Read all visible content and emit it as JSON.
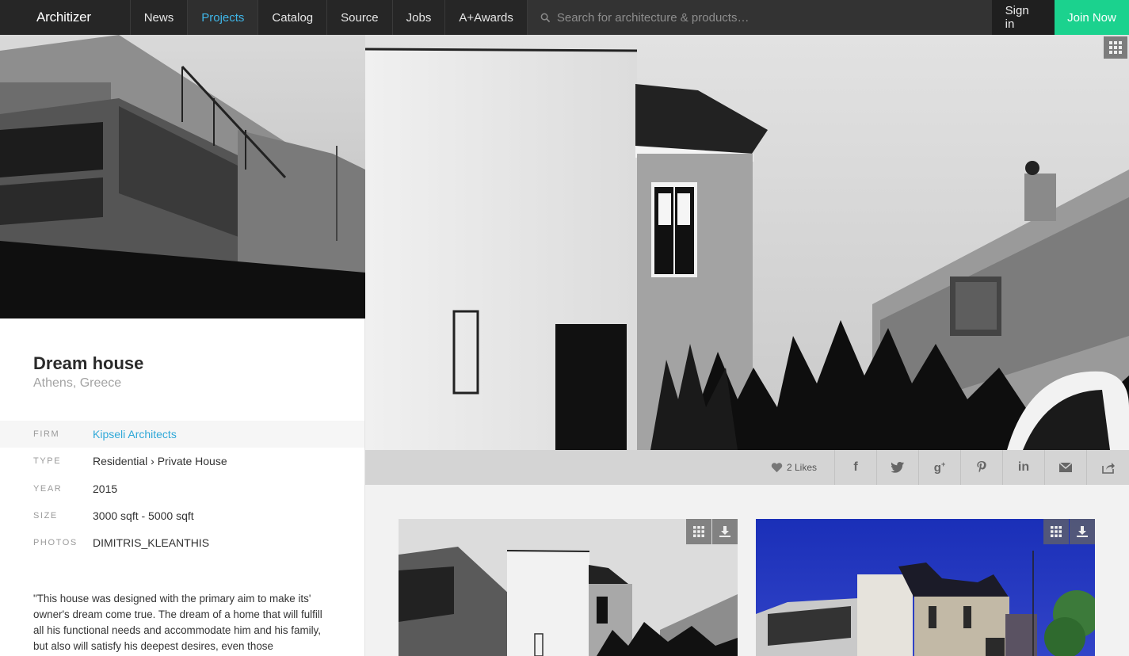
{
  "nav": {
    "logo": "Architizer",
    "items": [
      {
        "label": "News"
      },
      {
        "label": "Projects",
        "active": true
      },
      {
        "label": "Catalog"
      },
      {
        "label": "Source"
      },
      {
        "label": "Jobs"
      },
      {
        "label": "A+Awards"
      }
    ],
    "search_placeholder": "Search for architecture & products…",
    "signin": "Sign in",
    "join": "Join Now"
  },
  "project": {
    "title": "Dream house",
    "location": "Athens, Greece",
    "meta": [
      {
        "label": "FIRM",
        "value": "Kipseli Architects",
        "link": true
      },
      {
        "label": "TYPE",
        "value": "Residential › Private House"
      },
      {
        "label": "YEAR",
        "value": "2015"
      },
      {
        "label": "SIZE",
        "value": "3000 sqft - 5000 sqft"
      },
      {
        "label": "PHOTOS",
        "value": "DIMITRIS_KLEANTHIS"
      }
    ],
    "description": "\"This house was designed with the primary aim to make its' owner's dream come true. The dream of a home that will fulfill all his functional needs and accommodate him and his family, but also will satisfy his deepest desires, even those"
  },
  "share": {
    "likes": "2 Likes",
    "buttons": [
      "facebook",
      "twitter",
      "google-plus",
      "pinterest",
      "linkedin",
      "email",
      "share"
    ]
  },
  "colors": {
    "accent": "#3fb6e8",
    "join": "#1bd28e",
    "nav_bg": "#262626"
  }
}
